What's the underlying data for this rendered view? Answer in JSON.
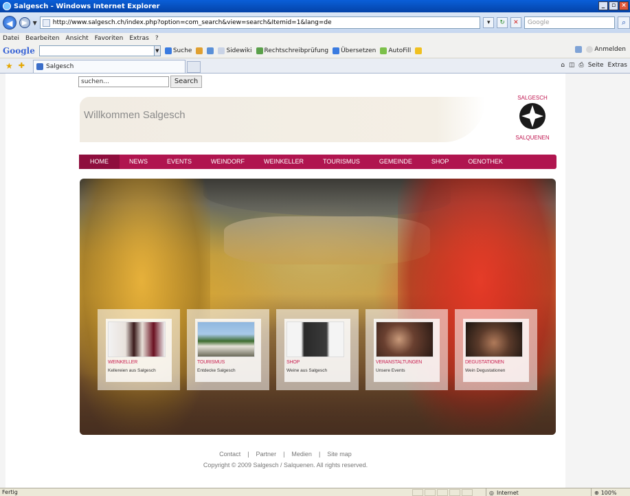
{
  "window": {
    "title": "Salgesch - Windows Internet Explorer",
    "min": "_",
    "max": "▫",
    "close": "×"
  },
  "addressbar": {
    "url": "http://www.salgesch.ch/index.php?option=com_search&view=search&Itemid=1&lang=de",
    "search_placeholder": "Google"
  },
  "menubar": {
    "items": [
      "Datei",
      "Bearbeiten",
      "Ansicht",
      "Favoriten",
      "Extras",
      "?"
    ]
  },
  "google_toolbar": {
    "logo": "Google",
    "search_label": "Suche",
    "sidewiki": "Sidewiki",
    "spellcheck": "Rechtschreibprüfung",
    "translate": "Übersetzen",
    "autofill": "AutoFill",
    "signin": "Anmelden"
  },
  "tabs": {
    "active_tab": "Salgesch",
    "page_menu": "Seite",
    "extras_menu": "Extras"
  },
  "site": {
    "search_value": "suchen...",
    "search_button": "Search",
    "welcome": "Willkommen Salgesch",
    "logo_top": "SALGESCH",
    "logo_bottom": "SALQUENEN",
    "nav": [
      "HOME",
      "NEWS",
      "EVENTS",
      "WEINDORF",
      "WEINKELLER",
      "TOURISMUS",
      "GEMEINDE",
      "SHOP",
      "OENOTHEK"
    ],
    "cards": [
      {
        "title": "WEINKELLER",
        "subtitle": "Kellereien aus Salgesch"
      },
      {
        "title": "TOURISMUS",
        "subtitle": "Entdecke Salgesch"
      },
      {
        "title": "SHOP",
        "subtitle": "Weine aus Salgesch"
      },
      {
        "title": "VERANSTALTUNGEN",
        "subtitle": "Unsere Events"
      },
      {
        "title": "DEGUSTATIONEN",
        "subtitle": "Wein Degustationen"
      }
    ],
    "footer_links": [
      "Contact",
      "Partner",
      "Medien",
      "Site map"
    ],
    "footer_sep": "|",
    "copyright": "Copyright © 2009 Salgesch / Salquenen. All rights reserved."
  },
  "status": {
    "text": "Fertig",
    "zone": "Internet",
    "zoom": "100%"
  },
  "colors": {
    "nav_bg": "#b0154f",
    "nav_active": "#8e0e3d",
    "card_title": "#c81e4f",
    "logo_red": "#c0154f"
  }
}
